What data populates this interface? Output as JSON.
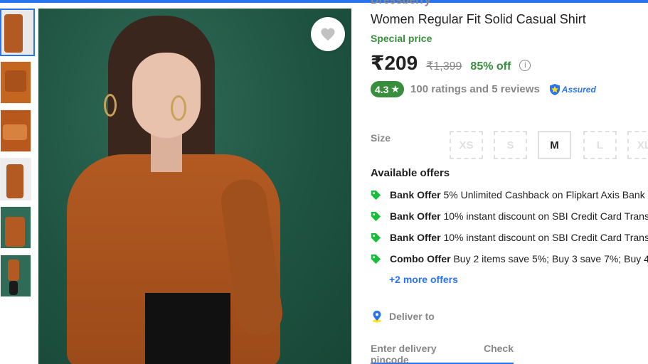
{
  "product": {
    "brand": "Dressberry",
    "title": "Women Regular Fit Solid Casual Shirt",
    "special_label": "Special price",
    "price": "₹209",
    "mrp": "₹1,399",
    "discount": "85% off",
    "info_icon": "i"
  },
  "rating": {
    "score": "4.3",
    "star": "★",
    "summary": "100 ratings and 5 reviews",
    "assured_label": "Assured"
  },
  "size": {
    "label": "Size",
    "options": [
      "XS",
      "S",
      "M",
      "L",
      "XL"
    ],
    "selected": "M"
  },
  "offers": {
    "title": "Available offers",
    "items": [
      {
        "kind": "Bank Offer",
        "text": "5% Unlimited Cashback on Flipkart Axis Bank"
      },
      {
        "kind": "Bank Offer",
        "text": "10% instant discount on SBI Credit Card Trans"
      },
      {
        "kind": "Bank Offer",
        "text": "10% instant discount on SBI Credit Card Trans"
      },
      {
        "kind": "Combo Offer",
        "text": "Buy 2 items save 5%; Buy 3 save 7%; Buy 4"
      }
    ],
    "more": "+2 more offers"
  },
  "delivery": {
    "label": "Deliver to",
    "pincode_placeholder": "Enter delivery pincode",
    "check": "Check"
  },
  "icons": {
    "wishlist": "heart-icon",
    "offer": "tag-icon",
    "location": "location-pin-icon"
  },
  "colors": {
    "accent": "#2874f0",
    "green": "#388e3c",
    "muted": "#878787"
  }
}
